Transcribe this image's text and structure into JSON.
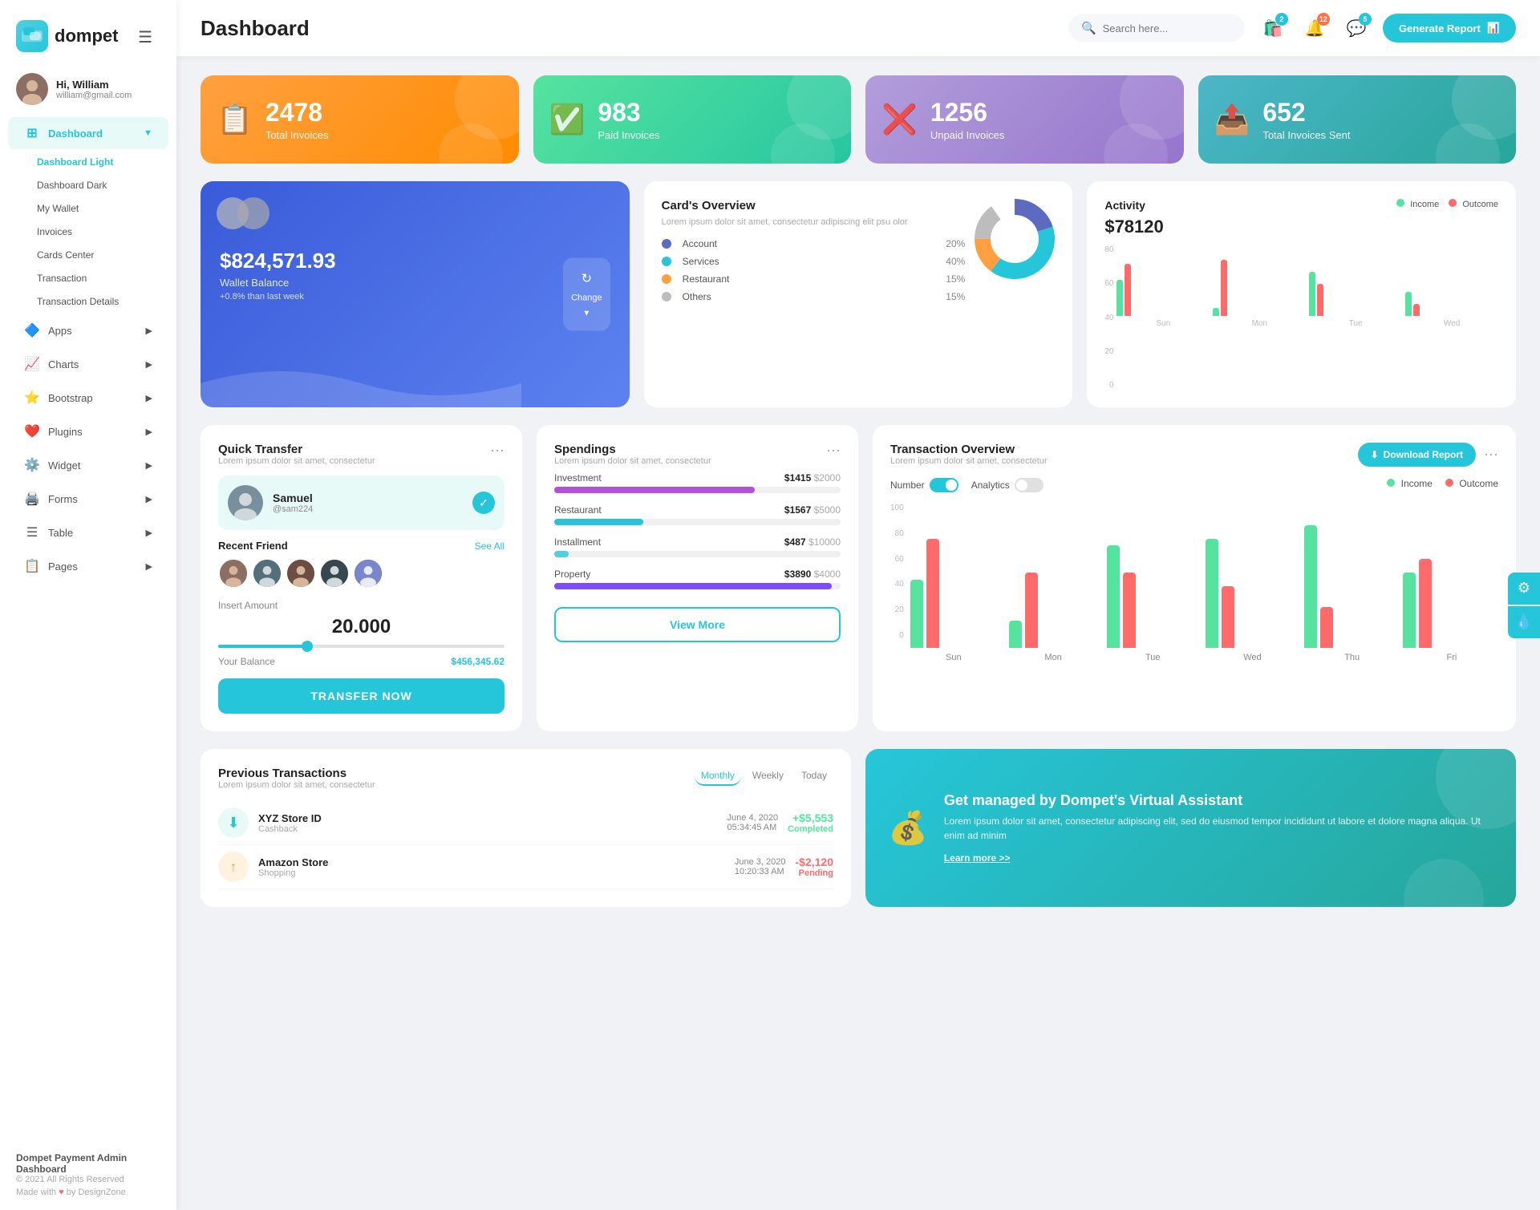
{
  "sidebar": {
    "logo": "dompet",
    "logo_icon": "💳",
    "user": {
      "hi": "Hi, William",
      "email": "william@gmail.com"
    },
    "menu": [
      {
        "id": "dashboard",
        "label": "Dashboard",
        "icon": "⊞",
        "active": true,
        "has_sub": true
      },
      {
        "id": "apps",
        "label": "Apps",
        "icon": "🔷",
        "has_sub": true
      },
      {
        "id": "charts",
        "label": "Charts",
        "icon": "📈",
        "has_sub": true
      },
      {
        "id": "bootstrap",
        "label": "Bootstrap",
        "icon": "⭐",
        "has_sub": true
      },
      {
        "id": "plugins",
        "label": "Plugins",
        "icon": "❤️",
        "has_sub": true
      },
      {
        "id": "widget",
        "label": "Widget",
        "icon": "⚙️",
        "has_sub": true
      },
      {
        "id": "forms",
        "label": "Forms",
        "icon": "🖨️",
        "has_sub": true
      },
      {
        "id": "table",
        "label": "Table",
        "icon": "☰",
        "has_sub": true
      },
      {
        "id": "pages",
        "label": "Pages",
        "icon": "📋",
        "has_sub": true
      }
    ],
    "submenu": [
      "Dashboard Light",
      "Dashboard Dark",
      "My Wallet",
      "Invoices",
      "Cards Center",
      "Transaction",
      "Transaction Details"
    ],
    "footer": {
      "app_name": "Dompet Payment Admin Dashboard",
      "copyright": "© 2021 All Rights Reserved",
      "made_with": "Made with",
      "by": "by DesignZone"
    }
  },
  "topbar": {
    "title": "Dashboard",
    "search_placeholder": "Search here...",
    "badges": {
      "cart": "2",
      "bell": "12",
      "chat": "5"
    },
    "generate_btn": "Generate Report"
  },
  "stat_cards": [
    {
      "id": "total",
      "number": "2478",
      "label": "Total Invoices",
      "icon": "📋",
      "color": "orange"
    },
    {
      "id": "paid",
      "number": "983",
      "label": "Paid Invoices",
      "icon": "✅",
      "color": "green"
    },
    {
      "id": "unpaid",
      "number": "1256",
      "label": "Unpaid Invoices",
      "icon": "❌",
      "color": "purple"
    },
    {
      "id": "sent",
      "number": "652",
      "label": "Total Invoices Sent",
      "icon": "📤",
      "color": "teal"
    }
  ],
  "wallet": {
    "amount": "$824,571.93",
    "label": "Wallet Balance",
    "change": "+0.8% than last week",
    "change_btn": "Change"
  },
  "card_overview": {
    "title": "Card's Overview",
    "subtitle": "Lorem ipsum dolor sit amet, consectetur adipiscing elit psu olor",
    "items": [
      {
        "label": "Account",
        "pct": "20%",
        "color": "#5c6bc0"
      },
      {
        "label": "Services",
        "pct": "40%",
        "color": "#26c6da"
      },
      {
        "label": "Restaurant",
        "pct": "15%",
        "color": "#ffa040"
      },
      {
        "label": "Others",
        "pct": "15%",
        "color": "#bdbdbd"
      }
    ]
  },
  "activity": {
    "title": "Activity",
    "amount": "$78120",
    "income_label": "Income",
    "outcome_label": "Outcome",
    "bars": [
      {
        "day": "Sun",
        "income": 45,
        "outcome": 65
      },
      {
        "day": "Mon",
        "income": 10,
        "outcome": 70
      },
      {
        "day": "Tue",
        "income": 55,
        "outcome": 40
      },
      {
        "day": "Wed",
        "income": 30,
        "outcome": 15
      }
    ],
    "y_labels": [
      "80",
      "60",
      "40",
      "20",
      "0"
    ]
  },
  "quick_transfer": {
    "title": "Quick Transfer",
    "subtitle": "Lorem ipsum dolor sit amet, consectetur",
    "contact": {
      "name": "Samuel",
      "username": "@sam224"
    },
    "recent_label": "Recent Friend",
    "see_all": "See All",
    "insert_amount": "Insert Amount",
    "amount": "20.000",
    "balance_label": "Your Balance",
    "balance": "$456,345.62",
    "transfer_btn": "TRANSFER NOW"
  },
  "spendings": {
    "title": "Spendings",
    "subtitle": "Lorem ipsum dolor sit amet, consectetur",
    "items": [
      {
        "label": "Investment",
        "current": "$1415",
        "max": "$2000",
        "pct": 70,
        "color": "#b44fd9"
      },
      {
        "label": "Restaurant",
        "current": "$1567",
        "max": "$5000",
        "pct": 31,
        "color": "#26c6da"
      },
      {
        "label": "Installment",
        "current": "$487",
        "max": "$10000",
        "pct": 5,
        "color": "#4dd0e1"
      },
      {
        "label": "Property",
        "current": "$3890",
        "max": "$4000",
        "pct": 97,
        "color": "#7c4dff"
      }
    ],
    "view_more": "View More"
  },
  "transaction_overview": {
    "title": "Transaction Overview",
    "subtitle": "Lorem ipsum dolor sit amet, consectetur",
    "download_btn": "Download Report",
    "toggle_number": "Number",
    "toggle_analytics": "Analytics",
    "income_label": "Income",
    "outcome_label": "Outcome",
    "bars": [
      {
        "day": "Sun",
        "income": 50,
        "outcome": 80
      },
      {
        "day": "Mon",
        "income": 20,
        "outcome": 55
      },
      {
        "day": "Tue",
        "income": 75,
        "outcome": 55
      },
      {
        "day": "Wed",
        "income": 80,
        "outcome": 45
      },
      {
        "day": "Thu",
        "income": 90,
        "outcome": 30
      },
      {
        "day": "Fri",
        "income": 55,
        "outcome": 65
      }
    ],
    "y_labels": [
      "100",
      "80",
      "60",
      "40",
      "20",
      "0"
    ]
  },
  "previous_transactions": {
    "title": "Previous Transactions",
    "subtitle": "Lorem ipsum dolor sit amet, consectetur",
    "tabs": [
      "Monthly",
      "Weekly",
      "Today"
    ],
    "active_tab": "Monthly",
    "items": [
      {
        "name": "XYZ Store ID",
        "type": "Cashback",
        "date": "June 4, 2020",
        "time": "05:34:45 AM",
        "amount": "+$5,553",
        "status": "Completed",
        "icon": "⬇"
      }
    ]
  },
  "virtual_assistant": {
    "title": "Get managed by Dompet's Virtual Assistant",
    "subtitle": "Lorem ipsum dolor sit amet, consectetur adipiscing elit, sed do eiusmod tempor incididunt ut labore et dolore magna aliqua. Ut enim ad minim",
    "link": "Learn more >>"
  },
  "right_sidebar": {
    "settings_icon": "⚙",
    "water_icon": "💧"
  }
}
